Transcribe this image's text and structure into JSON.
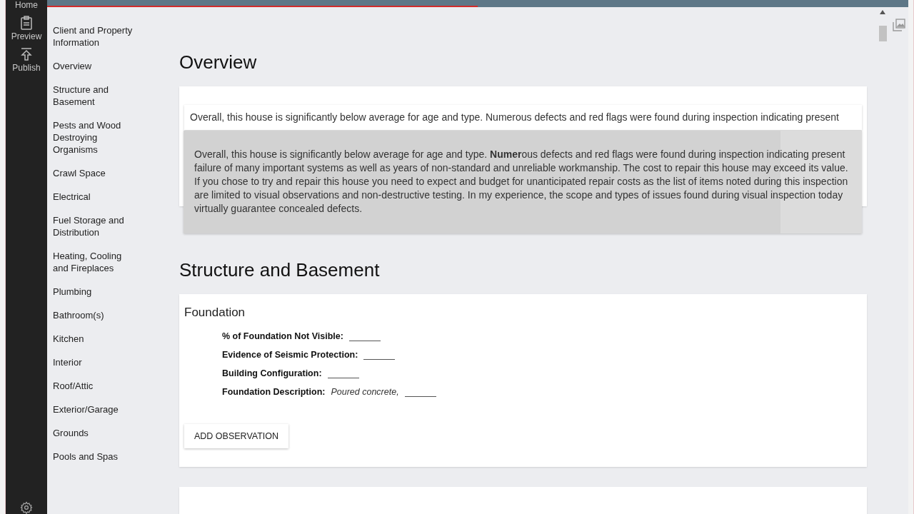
{
  "rail": [
    {
      "label": "Home",
      "kind": "label"
    },
    {
      "label": "Preview",
      "kind": "clipboard"
    },
    {
      "label": "Publish",
      "kind": "upload"
    }
  ],
  "progress": {
    "level": 0.5
  },
  "nav": [
    "Client and Property Information",
    "Overview",
    "Structure and Basement",
    "Pests and Wood Destroying Organisms",
    "Crawl Space",
    "Electrical",
    "Fuel Storage and Distribution",
    "Heating, Cooling and Fireplaces",
    "Plumbing",
    "Bathroom(s)",
    "Kitchen",
    "Interior",
    "Roof/Attic",
    "Exterior/Garage",
    "Grounds",
    "Pools and Spas"
  ],
  "overview": {
    "title": "Overview",
    "text": "Overall, this house is significantly below average for age and type. Numerous defects and red flags were found during inspection indicating present",
    "tooltip": "Overall, this house is significantly below average for age and type. **Numer**ous defects and red flags were found during inspection indicating present failure of many important systems as well as years of non-standard and unreliable workmanship. The cost to repair this house may exceed its value. If you chose to try and repair this house you need to expect and budget for unanticipated repair costs as the list of items noted during this inspection are limited to visual observations and non-destructive testing. In my experience, the scope and types of issues found during visual inspection today virtually guarantee concealed defects."
  },
  "structure": {
    "title": "Structure and Basement",
    "card_title": "Foundation",
    "fields": [
      {
        "label": "% of Foundation Not Visible:"
      },
      {
        "label": "Evidence of Seismic Protection:"
      },
      {
        "label": "Building Configuration:"
      },
      {
        "label": "Foundation Description:",
        "value": "Poured concrete,"
      }
    ],
    "button": "ADD OBSERVATION"
  }
}
